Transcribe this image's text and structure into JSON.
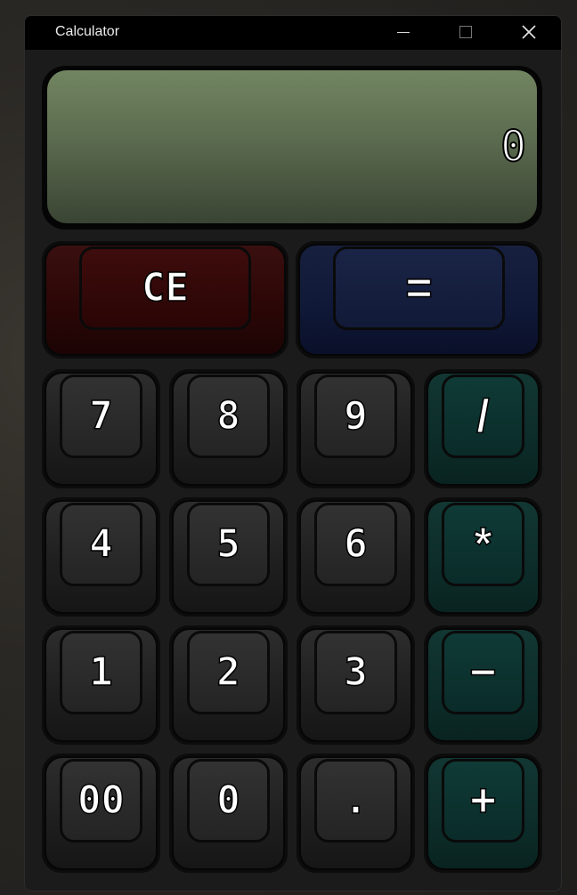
{
  "window": {
    "title": "Calculator"
  },
  "titlebar": {
    "minimize": "minimize",
    "maximize": "maximize",
    "close": "close"
  },
  "display": {
    "value": "0"
  },
  "keys": {
    "clear": "CE",
    "equals": "=",
    "seven": "7",
    "eight": "8",
    "nine": "9",
    "divide": "/",
    "four": "4",
    "five": "5",
    "six": "6",
    "multiply": "*",
    "one": "1",
    "two": "2",
    "three": "3",
    "subtract": "−",
    "double_zero": "00",
    "zero": "0",
    "decimal": ".",
    "add": "+"
  },
  "colors": {
    "display_screen": "#6b7d59",
    "clear_key": "#3a0808",
    "equals_key": "#131c3c",
    "operator_key": "#0c302c",
    "digit_key": "#262626"
  }
}
